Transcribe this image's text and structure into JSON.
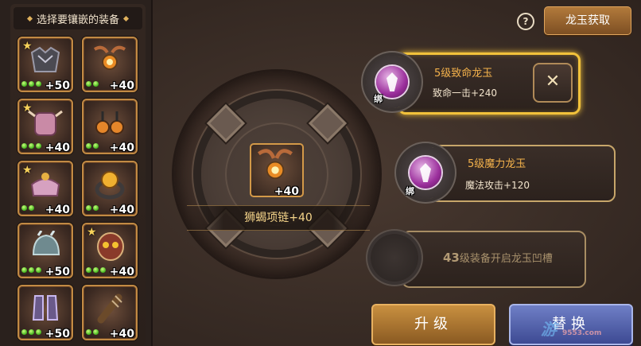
{
  "panel": {
    "title": "选择要镶嵌的装备",
    "items": [
      {
        "plus": "+50",
        "star": true,
        "dots": 3,
        "icon": "dark-armor-icon"
      },
      {
        "plus": "+40",
        "star": false,
        "dots": 2,
        "icon": "horn-necklace-icon"
      },
      {
        "plus": "+40",
        "star": true,
        "dots": 3,
        "icon": "pink-armor-icon"
      },
      {
        "plus": "+40",
        "star": false,
        "dots": 2,
        "icon": "orb-earrings-icon"
      },
      {
        "plus": "+40",
        "star": true,
        "dots": 2,
        "icon": "pink-belt-icon"
      },
      {
        "plus": "+40",
        "star": false,
        "dots": 2,
        "icon": "fire-ring-icon"
      },
      {
        "plus": "+50",
        "star": false,
        "dots": 3,
        "icon": "spiked-helmet-icon"
      },
      {
        "plus": "+40",
        "star": true,
        "dots": 3,
        "icon": "demon-shield-icon"
      },
      {
        "plus": "+50",
        "star": false,
        "dots": 3,
        "icon": "purple-boots-icon"
      },
      {
        "plus": "+40",
        "star": false,
        "dots": 2,
        "icon": "spiked-club-icon"
      }
    ]
  },
  "header": {
    "help": "?",
    "get_button": "龙玉获取"
  },
  "center": {
    "item_plus": "+40",
    "item_name": "狮蝎项链+40",
    "icon": "scorpion-necklace-icon"
  },
  "gems": [
    {
      "name": "5级致命龙玉",
      "stat": "致命一击+240",
      "bind": "绑",
      "state": "selected"
    },
    {
      "name": "5级魔力龙玉",
      "stat": "魔法攻击+120",
      "bind": "绑",
      "state": "normal"
    }
  ],
  "locked_slot": {
    "level": "43",
    "text": "级装备开启龙玉凹槽"
  },
  "close_label": "✕",
  "buttons": {
    "upgrade": "升级",
    "replace": "替换"
  },
  "watermark": {
    "main": "游",
    "sub": "9553.com"
  },
  "colors": {
    "accent_gold": "#f2c23b",
    "gem_name": "#f4b24b",
    "replace_blue": "#3d4a93"
  }
}
